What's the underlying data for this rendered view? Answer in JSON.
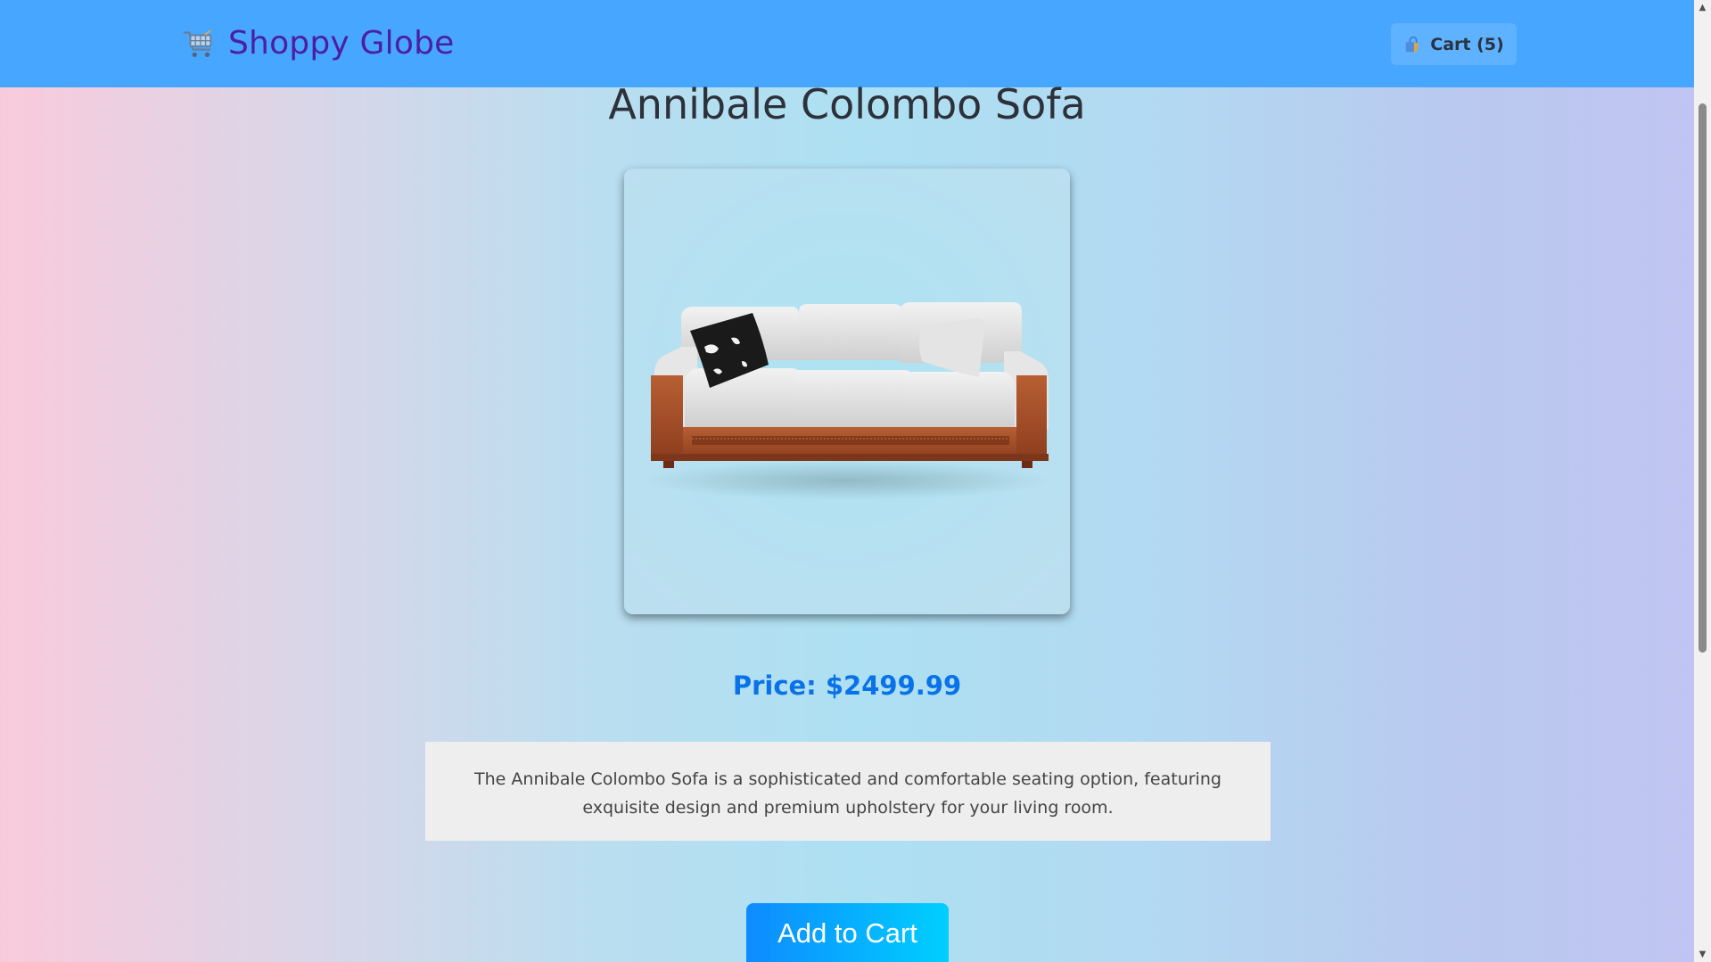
{
  "header": {
    "brand_name": "Shoppy Globe",
    "brand_icon": "shopping-cart-icon",
    "cart_label": "Cart (5)",
    "cart_icon": "shopping-bag-icon",
    "background_color": "#47a6ff"
  },
  "product": {
    "title": "Annibale Colombo Sofa",
    "image_alt": "sofa",
    "price_text": "Price: $2499.99",
    "description": "The Annibale Colombo Sofa is a sophisticated and comfortable seating option, featuring exquisite design and premium upholstery for your living room.",
    "add_to_cart_label": "Add to Cart"
  },
  "colors": {
    "brand_text": "#4b1fa0",
    "price_text": "#0a72e8",
    "button_gradient_start": "#0e8bff",
    "button_gradient_end": "#00cfff"
  }
}
